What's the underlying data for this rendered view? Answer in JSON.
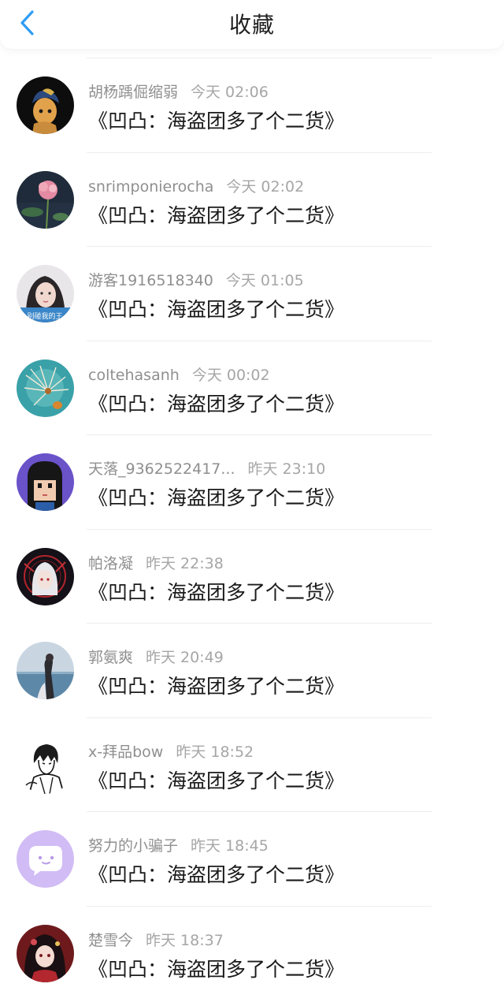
{
  "header": {
    "title": "收藏",
    "back_icon": "chevron-left-icon",
    "accent": "#2f9df4"
  },
  "items": [
    {
      "name": "胡杨踽倔缩弱",
      "time": "今天 02:06",
      "content": "《凹凸：海盗团多了个二货》"
    },
    {
      "name": "snrimponierocha",
      "time": "今天 02:02",
      "content": "《凹凸：海盗团多了个二货》"
    },
    {
      "name": "游客1916518340",
      "time": "今天 01:05",
      "content": "《凹凸：海盗团多了个二货》",
      "avatar_caption": "别碰我的王"
    },
    {
      "name": "coltehasanh",
      "time": "今天 00:02",
      "content": "《凹凸：海盗团多了个二货》"
    },
    {
      "name": "天落_9362522417...",
      "time": "昨天 23:10",
      "content": "《凹凸：海盗团多了个二货》"
    },
    {
      "name": "帕洛凝",
      "time": "昨天 22:38",
      "content": "《凹凸：海盗团多了个二货》"
    },
    {
      "name": "郭氨爽",
      "time": "昨天 20:49",
      "content": "《凹凸：海盗团多了个二货》"
    },
    {
      "name": "x-拜品bow",
      "time": "昨天 18:52",
      "content": "《凹凸：海盗团多了个二货》"
    },
    {
      "name": "努力的小骗子",
      "time": "昨天 18:45",
      "content": "《凹凸：海盗团多了个二货》"
    },
    {
      "name": "楚雪今",
      "time": "昨天 18:37",
      "content": "《凹凸：海盗团多了个二货》"
    }
  ]
}
